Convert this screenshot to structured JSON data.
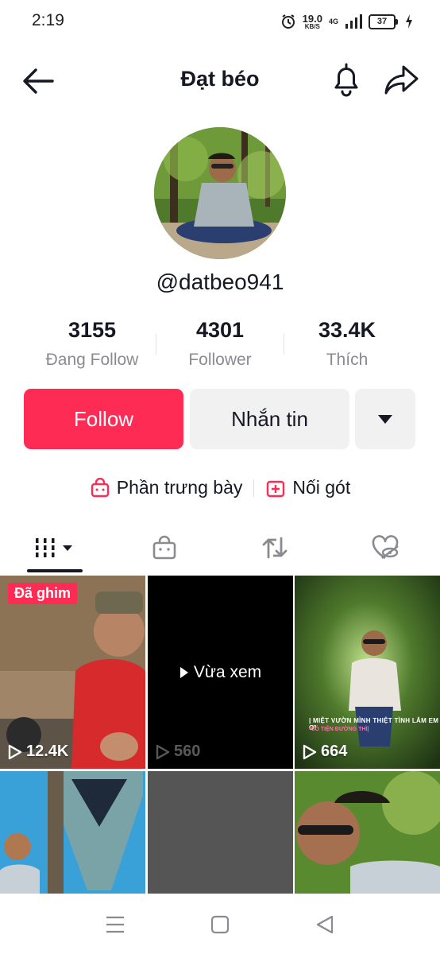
{
  "status_bar": {
    "time": "2:19",
    "net_speed_value": "19.0",
    "net_speed_unit": "KB/S",
    "network_type": "4G",
    "battery": "37"
  },
  "header": {
    "title": "Đạt béo",
    "icons": [
      "back-arrow-icon",
      "bell-icon",
      "share-icon"
    ]
  },
  "profile": {
    "username": "@datbeo941",
    "stats": [
      {
        "value": "3155",
        "label": "Đang Follow"
      },
      {
        "value": "4301",
        "label": "Follower"
      },
      {
        "value": "33.4K",
        "label": "Thích"
      }
    ]
  },
  "actions": {
    "follow_label": "Follow",
    "message_label": "Nhắn tin",
    "more_icon": "caret-down-icon"
  },
  "links": {
    "showcase_label": "Phần trưng bày",
    "stitch_label": "Nối gót"
  },
  "tabs": [
    "videos-grid-icon",
    "shop-bag-icon",
    "repost-icon",
    "liked-hidden-icon"
  ],
  "grid": {
    "pinned_label": "Đã ghim",
    "watched_label": "Vừa xem",
    "videos": [
      {
        "views": "12.4K"
      },
      {
        "views": "560"
      },
      {
        "views": "664"
      }
    ],
    "caption_line1": "| MIỆT VƯỜN MÌNH THIỆT TÌNH LẮM EM ƠI",
    "caption_line2": "•CÓ TIỆN ĐƯỜNG THÌ|"
  },
  "colors": {
    "accent": "#fe2c55",
    "secondary_button": "#f1f1f2",
    "muted_text": "#8a8b91"
  }
}
